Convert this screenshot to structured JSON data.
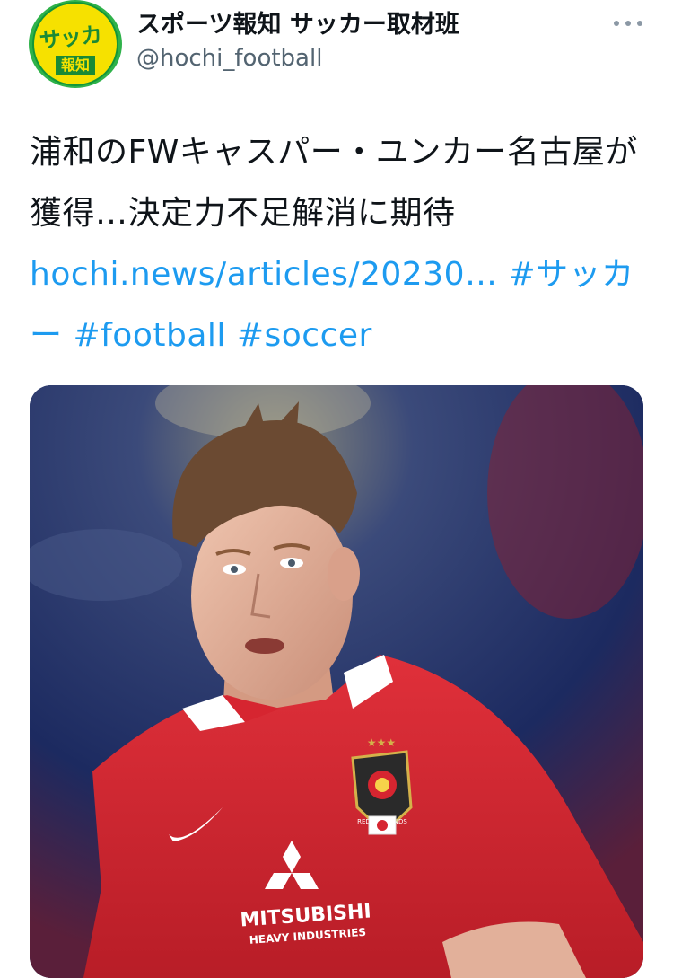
{
  "account": {
    "display_name": "スポーツ報知 サッカー取材班",
    "handle": "@hochi_football",
    "avatar": {
      "logo_top": "サッカー",
      "logo_bottom": "報知",
      "colors": {
        "outer": "#2fb24a",
        "inner": "#f6e100",
        "text": "#1a8a35"
      }
    }
  },
  "header": {
    "more_icon": "more-horizontal-icon"
  },
  "tweet": {
    "text": "浦和のFWキャスパー・ユンカー名古屋が獲得…決定力不足解消に期待 ",
    "link": "hochi.news/articles/20230…",
    "hashtags": [
      "#サッカー",
      "#football",
      "#soccer"
    ],
    "link_color": "#1d9bf0"
  },
  "media": {
    "sponsor_line1": "MITSUBISHI",
    "sponsor_line2": "HEAVY INDUSTRIES",
    "crest_text": "RED DIAMONDS",
    "colors": {
      "jersey": "#d8262f",
      "background": "#1b2a5c"
    }
  }
}
